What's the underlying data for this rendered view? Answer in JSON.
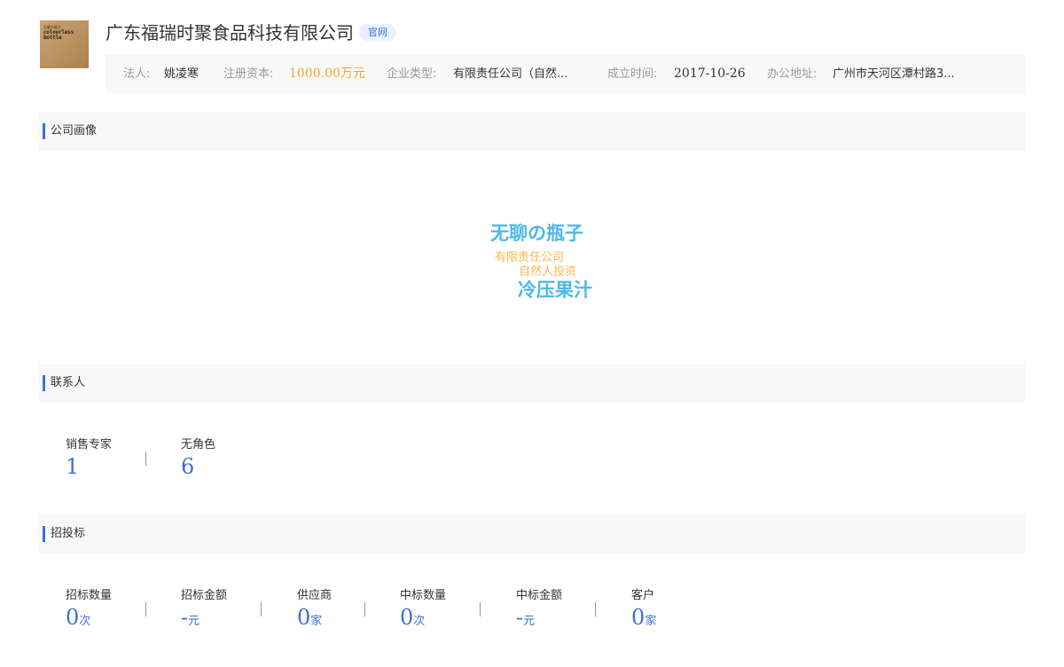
{
  "company": {
    "logo": {
      "tiny": "无聊の瓶子",
      "line1": "colourless",
      "line2": "bottle"
    },
    "name": "广东福瑞时聚食品科技有限公司",
    "badge": "官网",
    "info": {
      "legal_rep_label": "法人:",
      "legal_rep": "姚凌寒",
      "capital_label": "注册资本:",
      "capital": "1000.00万元",
      "type_label": "企业类型:",
      "type": "有限责任公司（自然...",
      "founded_label": "成立时间:",
      "founded": "2017-10-26",
      "address_label": "办公地址:",
      "address": "广州市天河区潭村路3..."
    }
  },
  "portrait": {
    "title": "公司画像",
    "words": [
      {
        "text": "无聊の瓶子",
        "color": "#4db8e8"
      },
      {
        "text": "有限责任公司",
        "color": "#f5b84a"
      },
      {
        "text": "自然人投资",
        "color": "#f5b84a"
      },
      {
        "text": "冷压果汁",
        "color": "#4db8e8"
      }
    ]
  },
  "contacts": {
    "title": "联系人",
    "stats": [
      {
        "label": "销售专家",
        "value": "1",
        "unit": ""
      },
      {
        "label": "无角色",
        "value": "6",
        "unit": ""
      }
    ]
  },
  "bidding": {
    "title": "招投标",
    "stats": [
      {
        "label": "招标数量",
        "value": "0",
        "unit": "次"
      },
      {
        "label": "招标金额",
        "value": "-",
        "unit": "元"
      },
      {
        "label": "供应商",
        "value": "0",
        "unit": "家"
      },
      {
        "label": "中标数量",
        "value": "0",
        "unit": "次"
      },
      {
        "label": "中标金额",
        "value": "-",
        "unit": "元"
      },
      {
        "label": "客户",
        "value": "0",
        "unit": "家"
      }
    ]
  },
  "colors": {
    "accent": "#3d6fdc",
    "orange": "#f5a623",
    "section_bg": "#f8f8f8"
  }
}
